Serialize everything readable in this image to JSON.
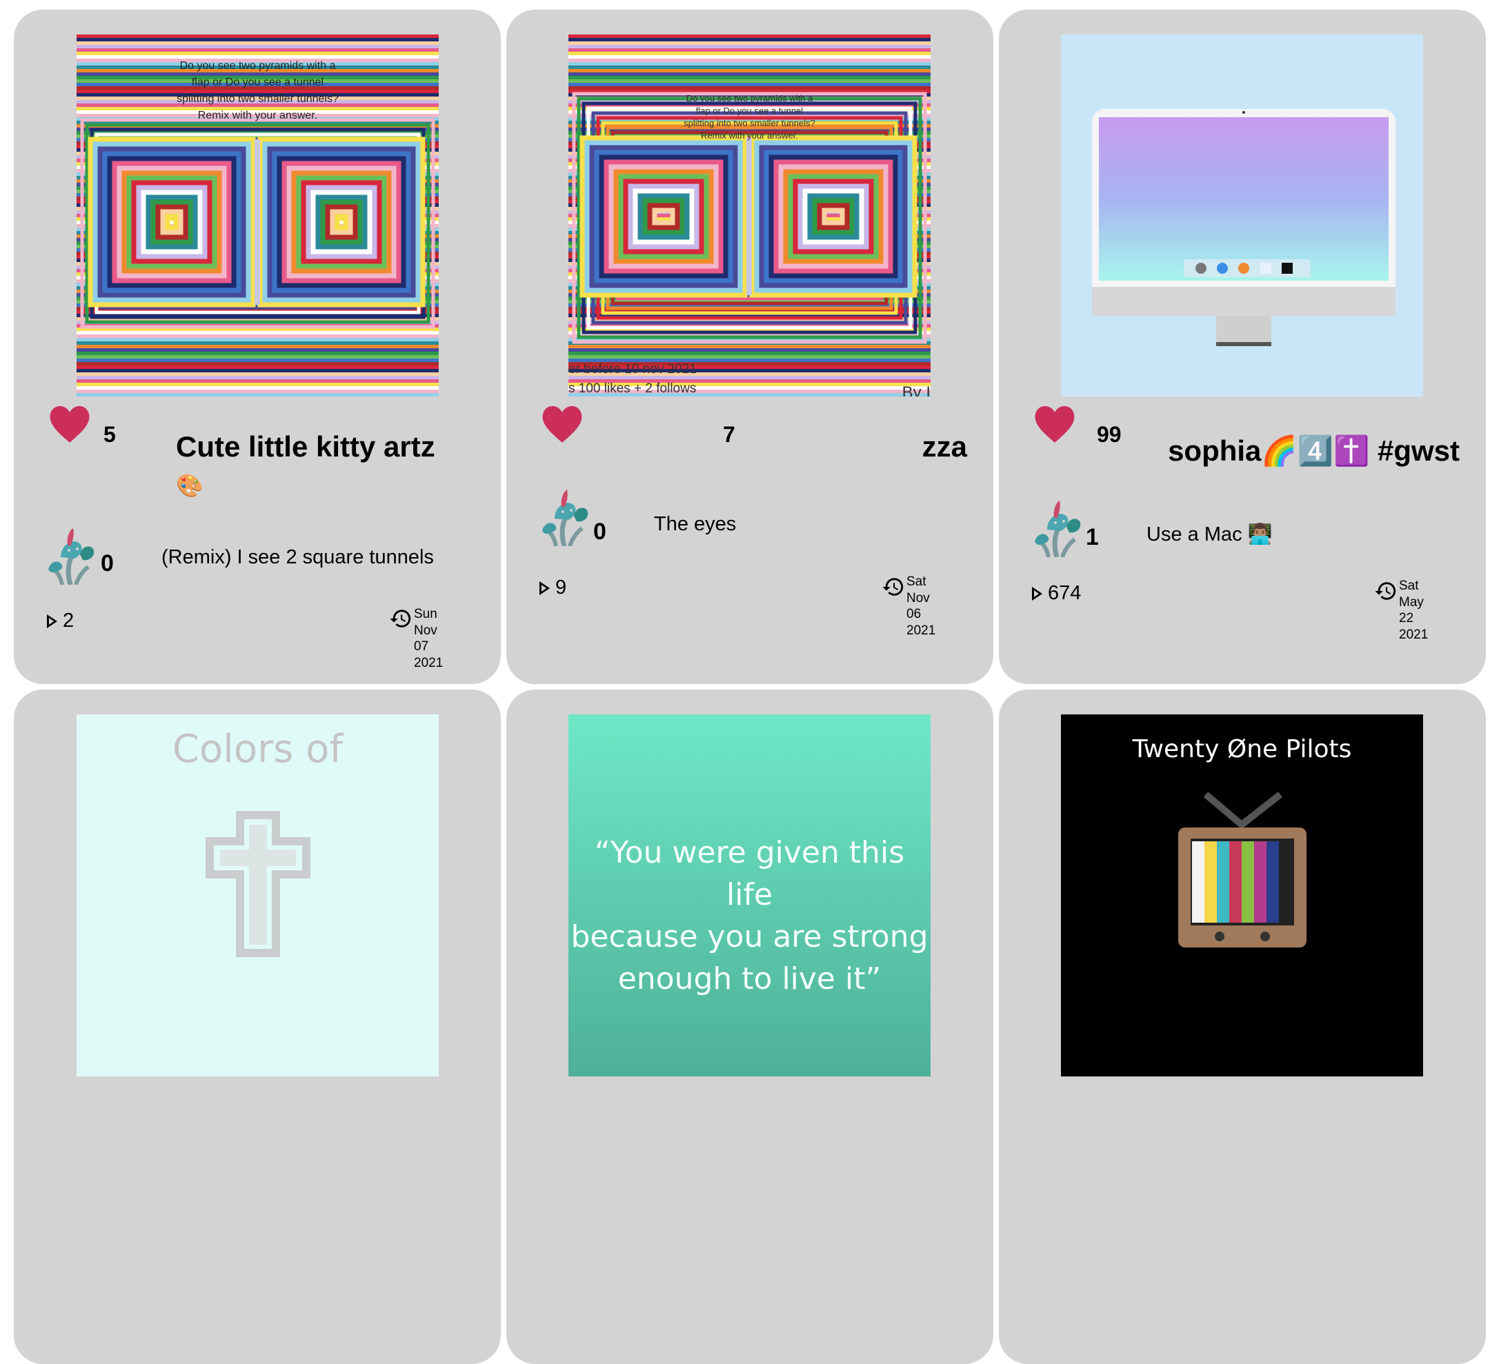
{
  "cards": [
    {
      "thumb_text": [
        "Do you see two pyramids with a",
        "flap or Do you see a tunnel",
        "splitting into two smaller tunnels?",
        "Remix with your answer."
      ],
      "likes": "5",
      "title": "Cute little kitty artz",
      "title_emoji": "🎨",
      "remixes": "0",
      "description": "(Remix) I see 2 square tunnels",
      "plays": "2",
      "date": [
        "Sun",
        "Nov",
        "07",
        "2021"
      ]
    },
    {
      "thumb_text": [
        "Do you see two pyramids with a",
        "flap or Do you see a tunnel",
        "splitting into two smaller tunnels?",
        "Remix with your answer."
      ],
      "thumb_footer": [
        "er before 10 nov 2021",
        "s 100 likes + 2 follows",
        "By I"
      ],
      "likes": "7",
      "title": "zza",
      "remixes": "0",
      "description": "The eyes",
      "plays": "9",
      "date": [
        "Sat",
        "Nov",
        "06",
        "2021"
      ]
    },
    {
      "likes": "99",
      "title": "sophia🌈4️⃣✝️ #gwst",
      "remixes": "1",
      "description": "Use a Mac 👨🏽‍💻",
      "plays": "674",
      "date": [
        "Sat",
        "May",
        "22",
        "2021"
      ]
    },
    {
      "thumb_text": "Colors of"
    },
    {
      "thumb_text": [
        "“You were given this life",
        "because you are strong",
        "enough to live it”"
      ]
    },
    {
      "thumb_text": "Twenty Øne Pilots"
    }
  ],
  "colors": {
    "card_bg": "#d3d3d3",
    "heart": "#cc2e5a"
  },
  "icons": [
    "heart-icon",
    "mushroom-remix-icon",
    "play-icon",
    "history-icon"
  ]
}
